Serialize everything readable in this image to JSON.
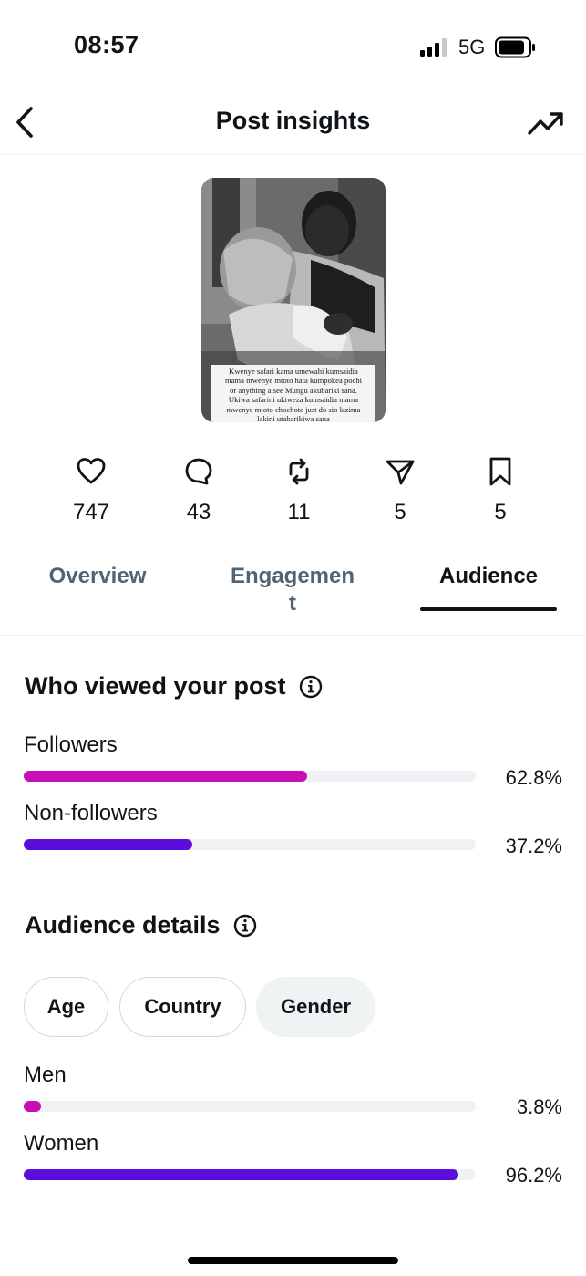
{
  "status_bar": {
    "time": "08:57",
    "network": "5G"
  },
  "header": {
    "title": "Post insights"
  },
  "thumbnail": {
    "caption_lines": [
      "Kwenye safari kama umewahi kumsaidia",
      "mama mwenye mtoto hata kumpokea pochi",
      "or anything aisee Mungu akubariki sana.",
      "Ukiwa safarini ukiweza kumsaidia mama",
      "mwenye mtoto chochote just do sio lazima",
      "lakini utabarikiwa sana"
    ]
  },
  "metrics": [
    {
      "icon": "heart-icon",
      "value": "747"
    },
    {
      "icon": "reply-icon",
      "value": "43"
    },
    {
      "icon": "repost-icon",
      "value": "11"
    },
    {
      "icon": "share-icon",
      "value": "5"
    },
    {
      "icon": "bookmark-icon",
      "value": "5"
    }
  ],
  "tabs": [
    {
      "label": "Overview",
      "active": false
    },
    {
      "label": "Engagemen\nt",
      "active": false
    },
    {
      "label": "Audience",
      "active": true
    }
  ],
  "who_viewed": {
    "title": "Who viewed your post",
    "rows": [
      {
        "label": "Followers",
        "value_text": "62.8%",
        "fraction": 0.628,
        "color": "#c90eb8"
      },
      {
        "label": "Non-followers",
        "value_text": "37.2%",
        "fraction": 0.372,
        "color": "#5b0ddb"
      }
    ]
  },
  "audience_details": {
    "title": "Audience details",
    "chips": [
      {
        "label": "Age",
        "selected": false
      },
      {
        "label": "Country",
        "selected": false
      },
      {
        "label": "Gender",
        "selected": true
      }
    ],
    "rows": [
      {
        "label": "Men",
        "value_text": "3.8%",
        "fraction": 0.038,
        "color": "#c90eb8"
      },
      {
        "label": "Women",
        "value_text": "96.2%",
        "fraction": 0.962,
        "color": "#5b0ddb"
      }
    ]
  }
}
